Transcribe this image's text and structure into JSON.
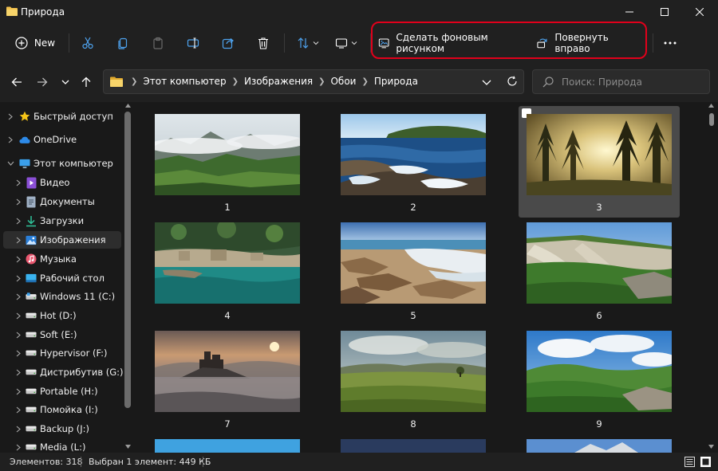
{
  "window": {
    "title": "Природа"
  },
  "toolbar": {
    "new_label": "New",
    "set_wallpaper_label": "Сделать фоновым рисунком",
    "rotate_right_label": "Повернуть вправо",
    "highlight_color": "#e0001b"
  },
  "address": {
    "crumbs": [
      "Этот компьютер",
      "Изображения",
      "Обои",
      "Природа"
    ],
    "search_placeholder": "Поиск: Природа"
  },
  "sidebar": {
    "items": [
      {
        "label": "Быстрый доступ",
        "icon": "star-icon"
      },
      {
        "label": "OneDrive",
        "icon": "cloud-icon"
      },
      {
        "label": "Этот компьютер",
        "icon": "monitor-icon"
      },
      {
        "label": "Видео",
        "icon": "video-icon"
      },
      {
        "label": "Документы",
        "icon": "document-icon"
      },
      {
        "label": "Загрузки",
        "icon": "download-icon"
      },
      {
        "label": "Изображения",
        "icon": "pictures-icon"
      },
      {
        "label": "Музыка",
        "icon": "music-icon"
      },
      {
        "label": "Рабочий стол",
        "icon": "desktop-icon"
      },
      {
        "label": "Windows 11 (C:)",
        "icon": "drive-icon"
      },
      {
        "label": "Hot (D:)",
        "icon": "drive-icon"
      },
      {
        "label": "Soft (E:)",
        "icon": "drive-icon"
      },
      {
        "label": "Hypervisor (F:)",
        "icon": "drive-icon"
      },
      {
        "label": "Дистрибутив (G:)",
        "icon": "drive-icon"
      },
      {
        "label": "Portable (H:)",
        "icon": "drive-icon"
      },
      {
        "label": "Помойка (I:)",
        "icon": "drive-icon"
      },
      {
        "label": "Backup (J:)",
        "icon": "drive-icon"
      },
      {
        "label": "Media (L:)",
        "icon": "drive-icon"
      }
    ]
  },
  "grid": {
    "items": [
      {
        "label": "1",
        "selected": false
      },
      {
        "label": "2",
        "selected": false
      },
      {
        "label": "3",
        "selected": true
      },
      {
        "label": "4",
        "selected": false
      },
      {
        "label": "5",
        "selected": false
      },
      {
        "label": "6",
        "selected": false
      },
      {
        "label": "7",
        "selected": false
      },
      {
        "label": "8",
        "selected": false
      },
      {
        "label": "9",
        "selected": false
      }
    ]
  },
  "status": {
    "count": "Элементов: 318",
    "selection": "Выбран 1 элемент: 449 КБ"
  },
  "colors": {
    "accent": "#0078d4",
    "folder": "#f2c14e"
  }
}
